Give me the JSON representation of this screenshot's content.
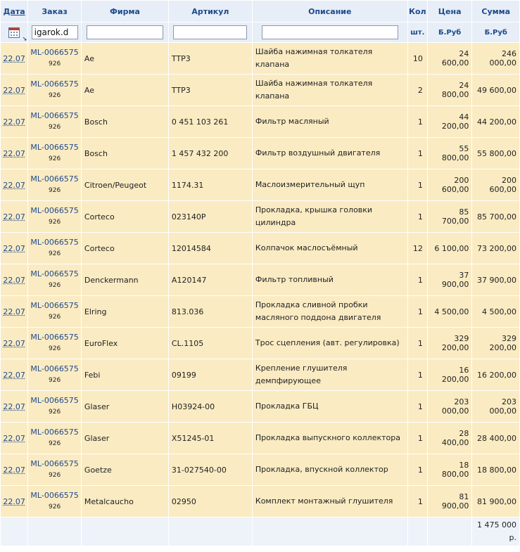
{
  "header": {
    "date": "Дата",
    "order": "Заказ",
    "firm": "Фирма",
    "article": "Артикул",
    "description": "Описание",
    "qty": "Кол",
    "price": "Цена",
    "sum": "Сумма",
    "sort_indicator": "↘"
  },
  "filters": {
    "order": "igarok.d",
    "firm": "",
    "article": "",
    "description": ""
  },
  "units": {
    "qty": "шт.",
    "price": "Б.Руб",
    "sum": "Б.Руб"
  },
  "rows": [
    {
      "date": "22.07",
      "order": "ML-0066575",
      "order_sub": "926",
      "firm": "Ae",
      "article": "TTP3",
      "description": "Шайба нажимная толкателя клапана",
      "qty": "10",
      "price": "24 600,00",
      "sum": "246 000,00"
    },
    {
      "date": "22.07",
      "order": "ML-0066575",
      "order_sub": "926",
      "firm": "Ae",
      "article": "TTP3",
      "description": "Шайба нажимная толкателя клапана",
      "qty": "2",
      "price": "24 800,00",
      "sum": "49 600,00"
    },
    {
      "date": "22.07",
      "order": "ML-0066575",
      "order_sub": "926",
      "firm": "Bosch",
      "article": "0 451 103 261",
      "description": "Фильтр масляный",
      "qty": "1",
      "price": "44 200,00",
      "sum": "44 200,00"
    },
    {
      "date": "22.07",
      "order": "ML-0066575",
      "order_sub": "926",
      "firm": "Bosch",
      "article": "1 457 432 200",
      "description": "Фильтр воздушный двигателя",
      "qty": "1",
      "price": "55 800,00",
      "sum": "55 800,00"
    },
    {
      "date": "22.07",
      "order": "ML-0066575",
      "order_sub": "926",
      "firm": "Citroen/Peugeot",
      "article": "1174.31",
      "description": "Маслоизмерительный щуп",
      "qty": "1",
      "price": "200 600,00",
      "sum": "200 600,00"
    },
    {
      "date": "22.07",
      "order": "ML-0066575",
      "order_sub": "926",
      "firm": "Corteco",
      "article": "023140P",
      "description": "Прокладка, крышка головки цилиндра",
      "qty": "1",
      "price": "85 700,00",
      "sum": "85 700,00"
    },
    {
      "date": "22.07",
      "order": "ML-0066575",
      "order_sub": "926",
      "firm": "Corteco",
      "article": "12014584",
      "description": "Колпачок маслосъёмный",
      "qty": "12",
      "price": "6 100,00",
      "sum": "73 200,00"
    },
    {
      "date": "22.07",
      "order": "ML-0066575",
      "order_sub": "926",
      "firm": "Denckermann",
      "article": "A120147",
      "description": "Фильтр топливный",
      "qty": "1",
      "price": "37 900,00",
      "sum": "37 900,00"
    },
    {
      "date": "22.07",
      "order": "ML-0066575",
      "order_sub": "926",
      "firm": "Elring",
      "article": "813.036",
      "description": "Прокладка сливной пробки масляного поддона двигателя",
      "qty": "1",
      "price": "4 500,00",
      "sum": "4 500,00"
    },
    {
      "date": "22.07",
      "order": "ML-0066575",
      "order_sub": "926",
      "firm": "EuroFlex",
      "article": "CL.1105",
      "description": "Трос сцепления (авт. регулировка)",
      "qty": "1",
      "price": "329 200,00",
      "sum": "329 200,00"
    },
    {
      "date": "22.07",
      "order": "ML-0066575",
      "order_sub": "926",
      "firm": "Febi",
      "article": "09199",
      "description": "Крепление глушителя демпфирующее",
      "qty": "1",
      "price": "16 200,00",
      "sum": "16 200,00"
    },
    {
      "date": "22.07",
      "order": "ML-0066575",
      "order_sub": "926",
      "firm": "Glaser",
      "article": "H03924-00",
      "description": "Прокладка ГБЦ",
      "qty": "1",
      "price": "203 000,00",
      "sum": "203 000,00"
    },
    {
      "date": "22.07",
      "order": "ML-0066575",
      "order_sub": "926",
      "firm": "Glaser",
      "article": "X51245-01",
      "description": "Прокладка выпускного коллектора",
      "qty": "1",
      "price": "28 400,00",
      "sum": "28 400,00"
    },
    {
      "date": "22.07",
      "order": "ML-0066575",
      "order_sub": "926",
      "firm": "Goetze",
      "article": "31-027540-00",
      "description": "Прокладка, впускной коллектор",
      "qty": "1",
      "price": "18 800,00",
      "sum": "18 800,00"
    },
    {
      "date": "22.07",
      "order": "ML-0066575",
      "order_sub": "926",
      "firm": "Metalcaucho",
      "article": "02950",
      "description": "Комплект монтажный глушителя",
      "qty": "1",
      "price": "81 900,00",
      "sum": "81 900,00"
    }
  ],
  "footer": {
    "total": "1 475 000",
    "total_unit": "р."
  },
  "colors": {
    "header_bg": "#e7eef7",
    "header_text": "#1e4a8c",
    "row_bg": "#faebc3",
    "footer_bg": "#eef3fa",
    "link": "#1e4a8c"
  }
}
